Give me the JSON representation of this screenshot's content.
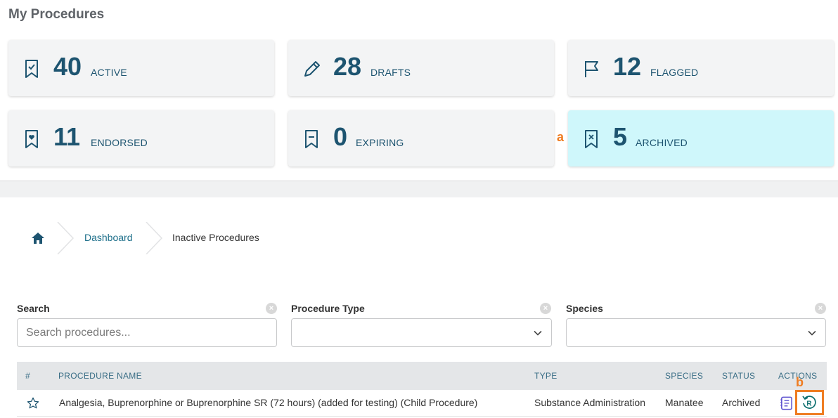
{
  "page": {
    "title": "My Procedures"
  },
  "cards": [
    {
      "count": "40",
      "label": "ACTIVE",
      "icon": "bookmark-check-icon"
    },
    {
      "count": "28",
      "label": "DRAFTS",
      "icon": "pencil-icon"
    },
    {
      "count": "12",
      "label": "FLAGGED",
      "icon": "flag-icon"
    },
    {
      "count": "11",
      "label": "ENDORSED",
      "icon": "bookmark-heart-icon"
    },
    {
      "count": "0",
      "label": "EXPIRING",
      "icon": "bookmark-minus-icon"
    },
    {
      "count": "5",
      "label": "ARCHIVED",
      "icon": "bookmark-x-icon"
    }
  ],
  "markers": {
    "a": "a",
    "b": "b"
  },
  "breadcrumb": {
    "home_icon": "home-icon",
    "items": [
      "Dashboard",
      "Inactive Procedures"
    ]
  },
  "filters": {
    "search": {
      "label": "Search",
      "placeholder": "Search procedures...",
      "value": ""
    },
    "procedure_type": {
      "label": "Procedure Type",
      "value": ""
    },
    "species": {
      "label": "Species",
      "value": ""
    },
    "clear_glyph": "×"
  },
  "table": {
    "columns": [
      "#",
      "PROCEDURE NAME",
      "TYPE",
      "SPECIES",
      "STATUS",
      "ACTIONS"
    ],
    "rows": [
      {
        "star_icon": "star-icon",
        "name": "Analgesia, Buprenorphine or Buprenorphine SR (72 hours) (added for testing) (Child Procedure)",
        "type": "Substance Administration",
        "species": "Manatee",
        "status": "Archived",
        "actions": [
          "view-document-icon",
          "restore-icon"
        ]
      }
    ]
  },
  "colors": {
    "accent": "#1d5470",
    "highlight": "#cff7fb",
    "marker": "#ef7d22",
    "link": "#1d6f8a",
    "action_purple": "#5a4fcf",
    "action_teal": "#0d6f6f"
  }
}
